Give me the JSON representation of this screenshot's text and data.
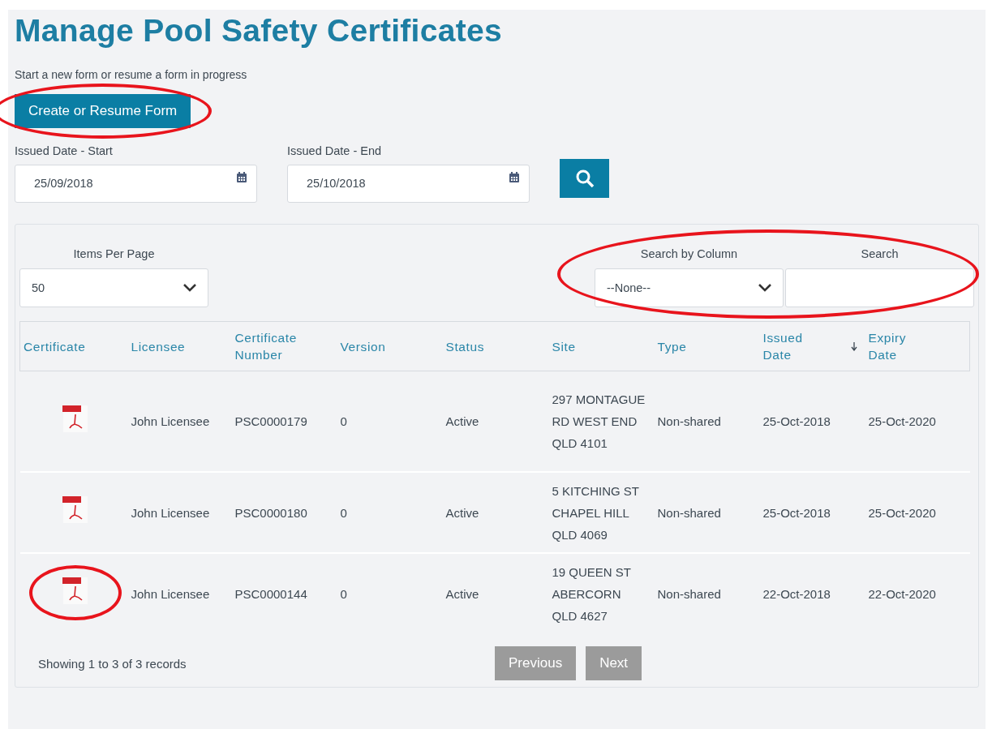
{
  "title": "Manage Pool Safety Certificates",
  "intro": "Start a new form or resume a form in progress",
  "create_button": "Create or Resume Form",
  "date_filters": [
    {
      "label": "Issued Date - Start",
      "value": "25/09/2018"
    },
    {
      "label": "Issued Date - End",
      "value": "25/10/2018"
    }
  ],
  "items_per_page": {
    "label": "Items Per Page",
    "value": "50"
  },
  "search_by_column": {
    "label": "Search by Column",
    "value": "--None--"
  },
  "search": {
    "label": "Search"
  },
  "table": {
    "columns": [
      {
        "label": "Certificate",
        "sorted": false
      },
      {
        "label": "Licensee",
        "sorted": false
      },
      {
        "label": "Certificate Number",
        "sorted": false
      },
      {
        "label": "Version",
        "sorted": false
      },
      {
        "label": "Status",
        "sorted": false
      },
      {
        "label": "Site",
        "sorted": false
      },
      {
        "label": "Type",
        "sorted": false
      },
      {
        "label": "Issued Date",
        "sorted": true
      },
      {
        "label": "Expiry Date",
        "sorted": false
      }
    ],
    "rows": [
      {
        "licensee": "John Licensee",
        "number": "PSC0000179",
        "version": "0",
        "status": "Active",
        "site": "297 MONTAGUE RD WEST END QLD 4101",
        "type": "Non-shared",
        "issued": "25-Oct-2018",
        "expiry": "25-Oct-2020"
      },
      {
        "licensee": "John Licensee",
        "number": "PSC0000180",
        "version": "0",
        "status": "Active",
        "site": "5 KITCHING ST CHAPEL HILL QLD 4069",
        "type": "Non-shared",
        "issued": "25-Oct-2018",
        "expiry": "25-Oct-2020"
      },
      {
        "licensee": "John Licensee",
        "number": "PSC0000144",
        "version": "0",
        "status": "Active",
        "site": "19 QUEEN ST ABERCORN QLD 4627",
        "type": "Non-shared",
        "issued": "22-Oct-2018",
        "expiry": "22-Oct-2020"
      }
    ]
  },
  "summary": "Showing 1 to 3 of 3 records",
  "pager": [
    {
      "label": "Previous",
      "disabled": true
    },
    {
      "label": "Next",
      "disabled": true
    }
  ]
}
